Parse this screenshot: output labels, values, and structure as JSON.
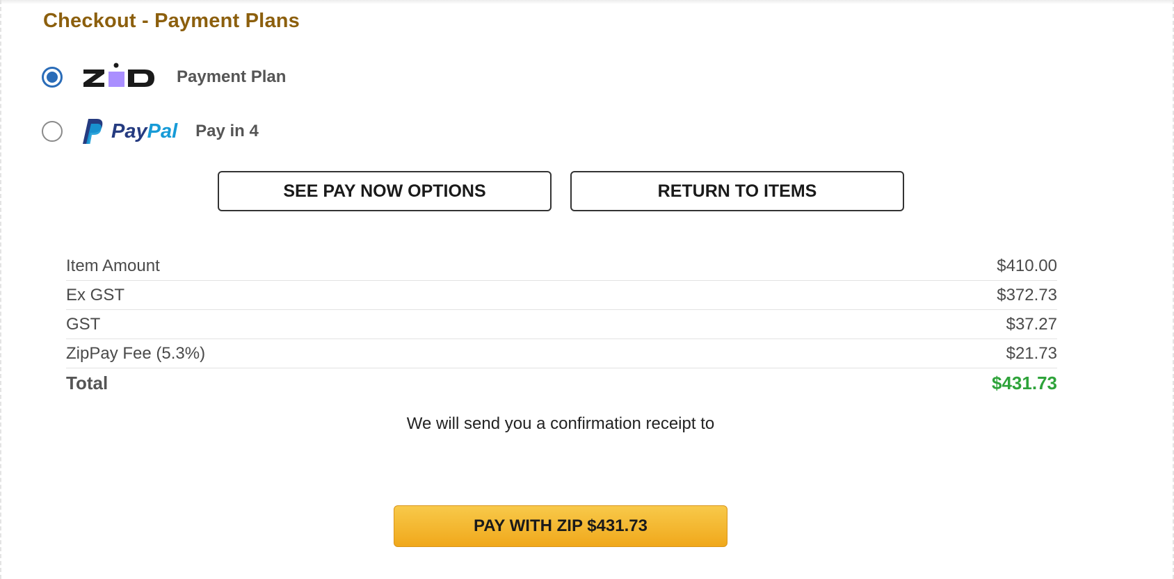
{
  "checkout": {
    "title": "Checkout - Payment Plans"
  },
  "payment_options": [
    {
      "brand": "zip",
      "brand_icon": "zip-logo-icon",
      "label": "Payment Plan",
      "selected": true
    },
    {
      "brand": "PayPal",
      "brand_icon": "paypal-logo-icon",
      "label": "Pay in 4",
      "selected": false
    }
  ],
  "actions": {
    "see_pay_now": "SEE PAY NOW OPTIONS",
    "return_to_items": "RETURN TO ITEMS",
    "pay": "PAY WITH ZIP $431.73"
  },
  "summary": {
    "rows": [
      {
        "label": "Item Amount",
        "value": "$410.00"
      },
      {
        "label": "Ex GST",
        "value": "$372.73"
      },
      {
        "label": "GST",
        "value": "$37.27"
      },
      {
        "label": "ZipPay Fee (5.3%)",
        "value": "$21.73"
      }
    ],
    "total_label": "Total",
    "total_value": "$431.73"
  },
  "receipt_text": "We will send you a confirmation receipt to",
  "colors": {
    "title": "#8c5f0d",
    "radio_selected": "#2a6cb8",
    "total_value": "#2ea33a",
    "pay_button": "#f4b52c",
    "zip_accent": "#aa8fff",
    "paypal_dark": "#253b80",
    "paypal_light": "#179bd7"
  }
}
